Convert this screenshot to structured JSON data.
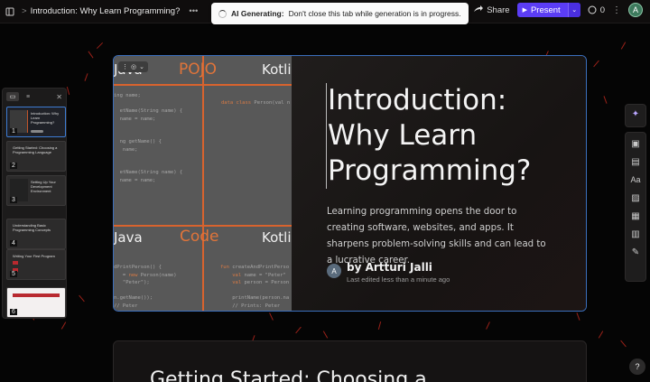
{
  "topbar": {
    "breadcrumb_sep": ">",
    "doc_title": "Introduction: Why Learn Programming?",
    "share_label": "Share",
    "present_label": "Present",
    "comment_count": "0",
    "user_initial": "A"
  },
  "status": {
    "bold": "AI Generating:",
    "message": "Don't close this tab while generation is in progress."
  },
  "thumbnails": [
    {
      "number": "1",
      "title": "Introduction: Why Learn Programming?"
    },
    {
      "number": "2",
      "title": "Getting Started: Choosing a Programming Language"
    },
    {
      "number": "3",
      "title": "Setting Up Your Development Environment"
    },
    {
      "number": "4",
      "title": "Understanding Basic Programming Concepts"
    },
    {
      "number": "5",
      "title": "Writing Your First Program"
    },
    {
      "number": "6",
      "title": ""
    }
  ],
  "slide": {
    "title": "Introduction: Why Learn Programming?",
    "body": "Learning programming opens the door to creating software, websites, and apps. It sharpens problem-solving skills and can lead to a lucrative career.",
    "author_initial": "A",
    "author_name": "by Artturi Jalli",
    "author_meta": "Last edited less than a minute ago",
    "image": {
      "label_java_top": "Java",
      "label_pojo": "POJO",
      "label_kotlin_top": "Kotlin",
      "label_java_bottom": "Java",
      "label_code": "Code",
      "label_kotlin_bottom": "Kotlin"
    }
  },
  "next_slide": {
    "title": "Getting Started: Choosing a"
  },
  "colors": {
    "accent": "#5b3df5",
    "selection": "#3b6fbd",
    "orange": "#d8632e"
  }
}
